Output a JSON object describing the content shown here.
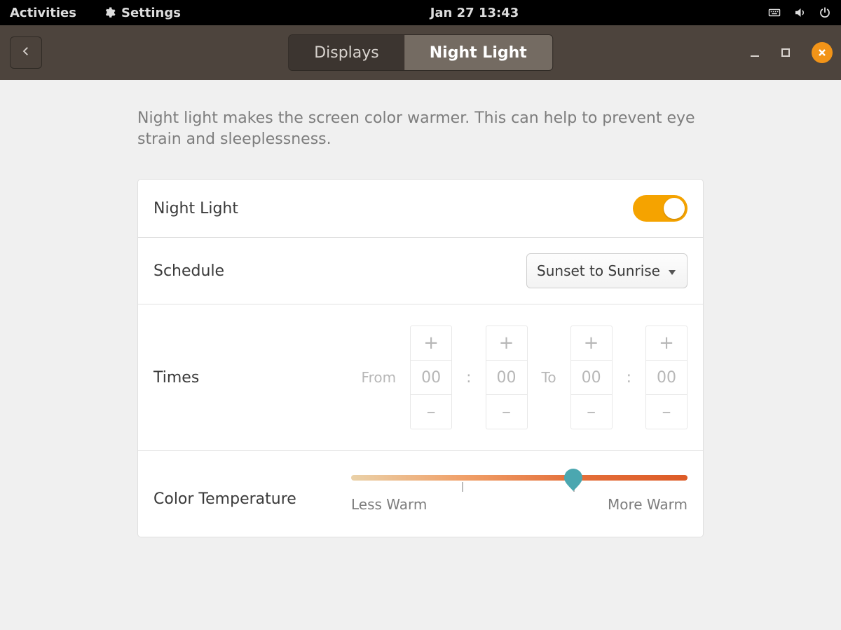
{
  "topbar": {
    "activities": "Activities",
    "app_name": "Settings",
    "clock": "Jan 27  13:43"
  },
  "header": {
    "tabs": {
      "displays": "Displays",
      "night_light": "Night Light"
    },
    "active_tab": "night_light"
  },
  "page": {
    "description": "Night light makes the screen color warmer. This can help to prevent eye strain and sleeplessness."
  },
  "rows": {
    "night_light": {
      "label": "Night Light",
      "enabled": true
    },
    "schedule": {
      "label": "Schedule",
      "value": "Sunset to Sunrise"
    },
    "times": {
      "label": "Times",
      "from_label": "From",
      "to_label": "To",
      "from_h": "00",
      "from_m": "00",
      "to_h": "00",
      "to_m": "00",
      "plus": "+",
      "minus": "–",
      "colon": ":",
      "enabled": false
    },
    "color_temp": {
      "label": "Color Temperature",
      "left": "Less Warm",
      "right": "More Warm",
      "value_percent": 66
    }
  },
  "colors": {
    "accent": "#f5a300",
    "close": "#f29418",
    "slider_thumb": "#4ba7b0"
  }
}
